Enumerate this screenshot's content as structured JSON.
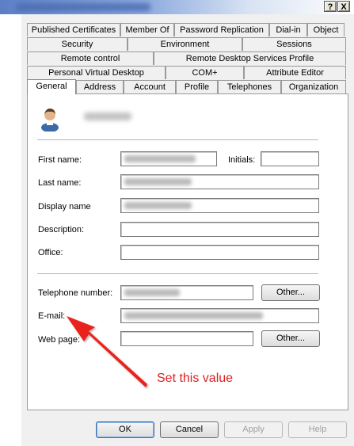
{
  "window": {
    "help_button": "?",
    "close_button": "X"
  },
  "tabs_row1": [
    "Published Certificates",
    "Member Of",
    "Password Replication",
    "Dial-in",
    "Object"
  ],
  "tabs_row2": [
    "Security",
    "Environment",
    "Sessions"
  ],
  "tabs_row3": [
    "Remote control",
    "Remote Desktop Services Profile"
  ],
  "tabs_row4": [
    "Personal Virtual Desktop",
    "COM+",
    "Attribute Editor"
  ],
  "tabs_row5": [
    "General",
    "Address",
    "Account",
    "Profile",
    "Telephones",
    "Organization"
  ],
  "active_tab": "General",
  "general": {
    "first_name_label": "First name:",
    "initials_label": "Initials:",
    "last_name_label": "Last name:",
    "display_name_label": "Display name",
    "description_label": "Description:",
    "office_label": "Office:",
    "telephone_label": "Telephone number:",
    "email_label": "E-mail:",
    "webpage_label": "Web page:",
    "other_button": "Other...",
    "description_value": "",
    "office_value": "",
    "webpage_value": "",
    "initials_value": ""
  },
  "buttons": {
    "ok": "OK",
    "cancel": "Cancel",
    "apply": "Apply",
    "help": "Help"
  },
  "annotation": {
    "text": "Set this value",
    "color": "#e02020"
  },
  "icons": {
    "user": "user-icon",
    "arrow": "red-arrow"
  }
}
